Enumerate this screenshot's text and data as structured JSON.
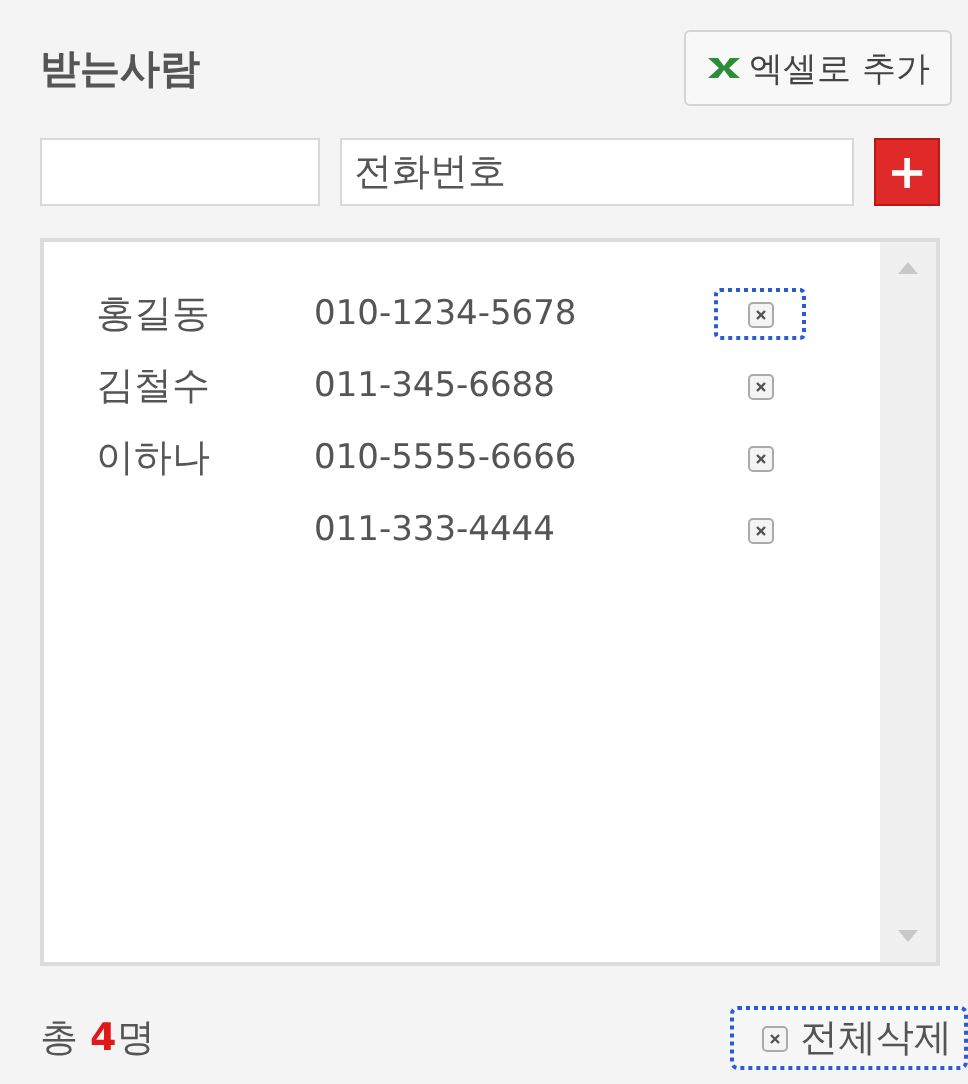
{
  "title": "받는사람",
  "excel_button": {
    "label": "엑셀로 추가"
  },
  "phone_field": {
    "placeholder": "전화번호"
  },
  "add_button": {
    "label": "+"
  },
  "recipients": [
    {
      "name": "홍길동",
      "phone": "010-1234-5678",
      "focused": true
    },
    {
      "name": "김철수",
      "phone": "011-345-6688",
      "focused": false
    },
    {
      "name": "이하나",
      "phone": "010-5555-6666",
      "focused": false
    },
    {
      "phone": "011-333-4444",
      "focused": false
    }
  ],
  "footer": {
    "count": "총 **4**명",
    "delete_all": {
      "label": "전체삭제",
      "focused": true
    }
  }
}
